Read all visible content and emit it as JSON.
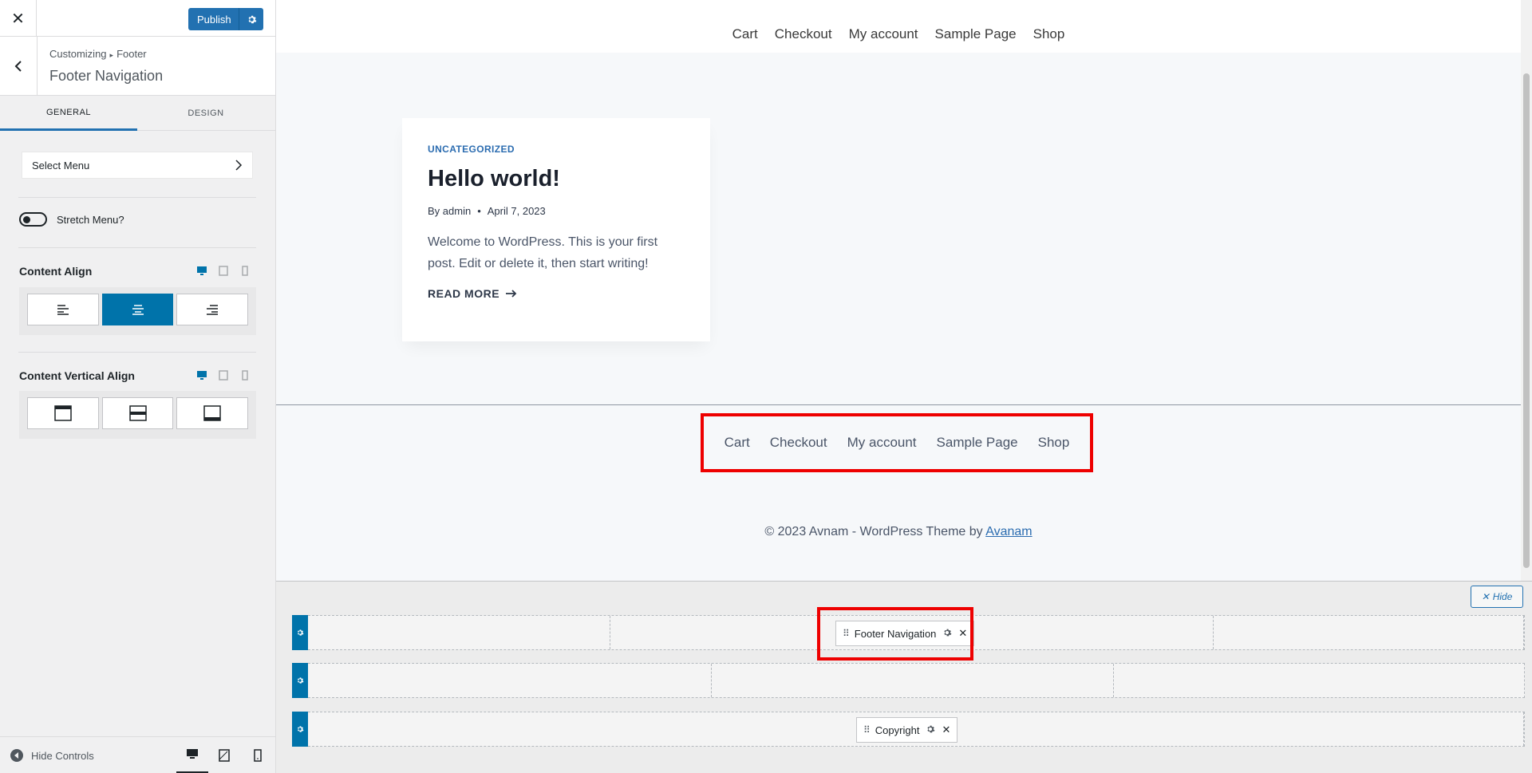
{
  "sidebar": {
    "publish_label": "Publish",
    "breadcrumb": {
      "root": "Customizing",
      "section": "Footer"
    },
    "section_title": "Footer Navigation",
    "tabs": [
      {
        "label": "GENERAL"
      },
      {
        "label": "DESIGN"
      }
    ],
    "select_menu_label": "Select Menu",
    "stretch_label": "Stretch Menu?",
    "content_align_title": "Content Align",
    "content_valign_title": "Content Vertical Align",
    "hide_controls_label": "Hide Controls"
  },
  "preview": {
    "header_nav": [
      "Cart",
      "Checkout",
      "My account",
      "Sample Page",
      "Shop"
    ],
    "post": {
      "category": "UNCATEGORIZED",
      "title": "Hello world!",
      "author": "By admin",
      "date": "April 7, 2023",
      "excerpt": "Welcome to WordPress. This is your first post. Edit or delete it, then start writing!",
      "read_more": "READ MORE"
    },
    "footer_nav": [
      "Cart",
      "Checkout",
      "My account",
      "Sample Page",
      "Shop"
    ],
    "copyright_text": "© 2023 Avnam - WordPress Theme by ",
    "copyright_link": "Avanam"
  },
  "builder": {
    "hide_label": "Hide",
    "footer_nav_chip": "Footer Navigation",
    "copyright_chip": "Copyright"
  },
  "colors": {
    "accent": "#2271b1",
    "active_button": "#0073aa",
    "highlight": "#ee0000"
  }
}
